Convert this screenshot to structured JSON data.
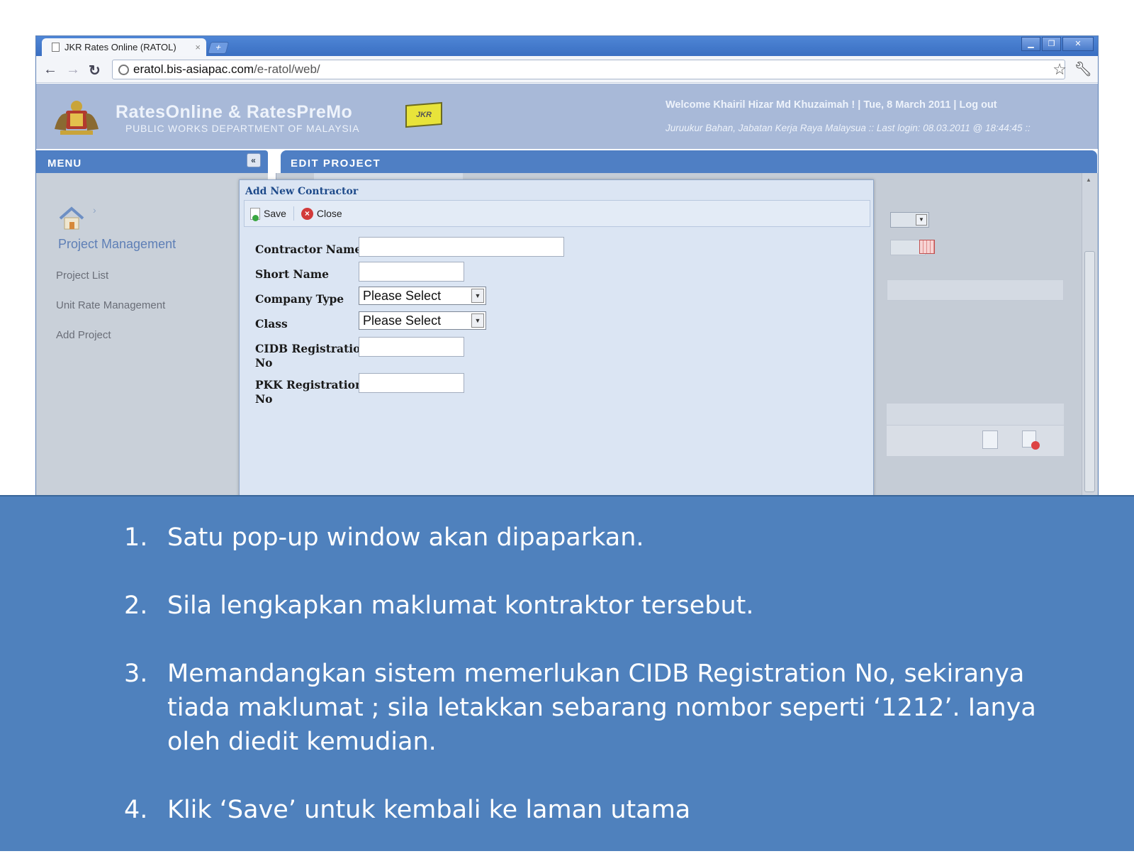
{
  "browser": {
    "tab_title": "JKR Rates Online (RATOL)",
    "tab_close": "×",
    "new_tab": "+",
    "url_host": "eratol.bis-asiapac.com",
    "url_path": "/e-ratol/web/"
  },
  "header": {
    "app_title": "RatesOnline & RatesPreMo",
    "app_subtitle": "PUBLIC WORKS DEPARTMENT OF MALAYSIA",
    "logo_text": "JKR",
    "welcome": "Welcome Khairil Hizar Md Khuzaimah ! | Tue, 8 March 2011 | Log out",
    "last_login": "Juruukur Bahan, Jabatan Kerja Raya Malaysua :: Last login: 08.03.2011 @ 18:44:45 ::"
  },
  "menu": {
    "heading": "MENU",
    "collapse": "«",
    "section_title": "Project Management",
    "items": [
      {
        "label": "Project List"
      },
      {
        "label": "Unit Rate Management"
      },
      {
        "label": "Add Project"
      }
    ]
  },
  "edit_project": {
    "heading": "EDIT PROJECT"
  },
  "dialog": {
    "title": "Add New Contractor",
    "save_label": "Save",
    "close_label": "Close",
    "fields": {
      "contractor_name": {
        "label": "Contractor Name",
        "value": ""
      },
      "short_name": {
        "label": "Short Name",
        "value": ""
      },
      "company_type": {
        "label": "Company Type",
        "value": "Please Select"
      },
      "class": {
        "label": "Class",
        "value": "Please Select"
      },
      "cidb_no": {
        "label_1": "CIDB Registration",
        "label_2": "No",
        "value": ""
      },
      "pkk_no": {
        "label_1": "PKK Registration",
        "label_2": "No",
        "value": ""
      }
    }
  },
  "instructions": [
    {
      "num": "1.",
      "text": "Satu pop-up window akan dipaparkan."
    },
    {
      "num": "2.",
      "text": "Sila lengkapkan maklumat kontraktor tersebut."
    },
    {
      "num": "3.",
      "text": "Memandangkan sistem memerlukan CIDB Registration No, sekiranya tiada maklumat ; sila letakkan sebarang nombor seperti ‘1212’. Ianya oleh diedit kemudian."
    },
    {
      "num": "4.",
      "text": "Klik ‘Save’ untuk kembali ke laman utama"
    }
  ]
}
